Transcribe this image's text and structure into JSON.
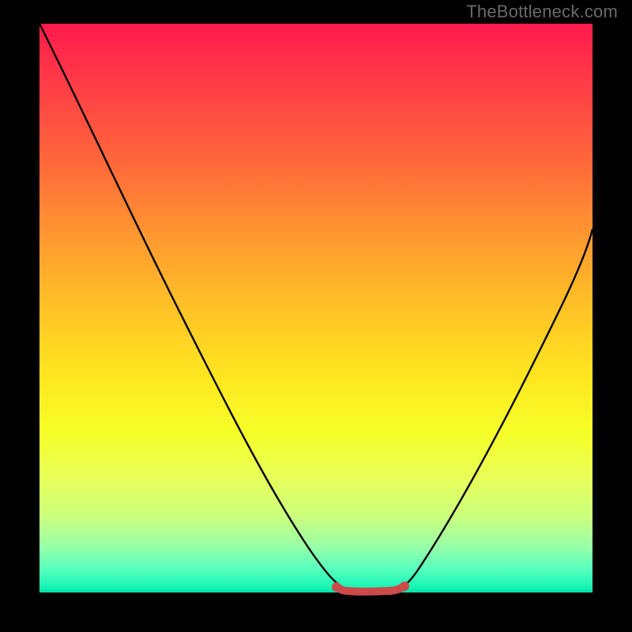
{
  "watermark": "TheBottleneck.com",
  "colors": {
    "page_bg": "#000000",
    "watermark": "#6a6a6a",
    "curve": "#000000",
    "baseline": "#cc4a4a",
    "gradient_stops": [
      "#ff1a4d",
      "#ff3a47",
      "#ff6a3a",
      "#ff9a30",
      "#ffc226",
      "#ffe620",
      "#f6ff28",
      "#e8ff5a",
      "#c8ff80",
      "#97ffa8",
      "#55ffbe",
      "#18f5b5",
      "#00e0a8"
    ]
  },
  "chart_data": {
    "type": "line",
    "title": "",
    "xlabel": "",
    "ylabel": "",
    "xlim": [
      0,
      100
    ],
    "ylim": [
      0,
      100
    ],
    "grid": false,
    "legend": false,
    "notes": "V-shaped bottleneck curve on vertical heat gradient. Axes unlabeled; values estimated from pixel positions (0–100 normalized).",
    "series": [
      {
        "name": "bottleneck-curve",
        "x": [
          0,
          5,
          10,
          15,
          20,
          25,
          30,
          35,
          40,
          45,
          50,
          53,
          56,
          60,
          64,
          66,
          70,
          75,
          80,
          85,
          90,
          95,
          100
        ],
        "y": [
          100,
          91,
          82,
          73,
          64,
          55,
          46,
          37,
          28,
          19,
          10,
          5,
          2,
          0,
          0,
          2,
          6,
          14,
          23,
          33,
          44,
          55,
          67
        ]
      }
    ],
    "baseline_segment": {
      "name": "optimal-range",
      "x": [
        53,
        66
      ],
      "y": [
        0,
        0
      ]
    }
  }
}
